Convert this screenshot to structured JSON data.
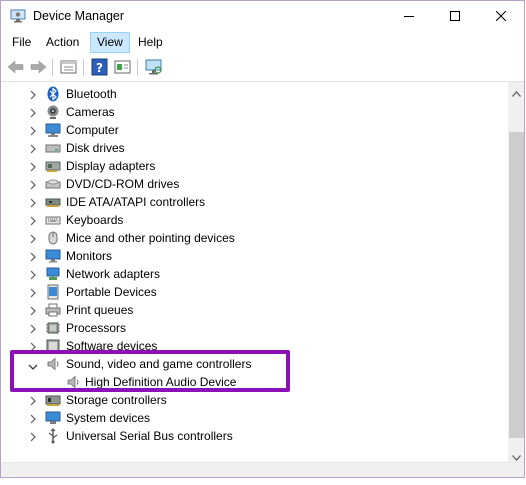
{
  "window": {
    "title": "Device Manager"
  },
  "titlebar": {
    "icon": "device-manager-icon",
    "minimize_icon": "minimize-icon",
    "maximize_icon": "maximize-icon",
    "close_icon": "close-icon"
  },
  "menubar": {
    "items": [
      "File",
      "Action",
      "View",
      "Help"
    ],
    "active": "View"
  },
  "toolbar": {
    "icons": [
      "back-arrow-icon",
      "forward-arrow-icon",
      "properties-icon",
      "help-icon",
      "show-hidden-icon",
      "scan-hardware-icon"
    ]
  },
  "tree": {
    "items": [
      {
        "label": "Bluetooth",
        "icon": "bluetooth-icon"
      },
      {
        "label": "Cameras",
        "icon": "camera-icon"
      },
      {
        "label": "Computer",
        "icon": "computer-icon"
      },
      {
        "label": "Disk drives",
        "icon": "disk-drive-icon"
      },
      {
        "label": "Display adapters",
        "icon": "display-adapter-icon"
      },
      {
        "label": "DVD/CD-ROM drives",
        "icon": "dvd-drive-icon"
      },
      {
        "label": "IDE ATA/ATAPI controllers",
        "icon": "ide-controller-icon"
      },
      {
        "label": "Keyboards",
        "icon": "keyboard-icon"
      },
      {
        "label": "Mice and other pointing devices",
        "icon": "mouse-icon"
      },
      {
        "label": "Monitors",
        "icon": "monitor-icon"
      },
      {
        "label": "Network adapters",
        "icon": "network-adapter-icon"
      },
      {
        "label": "Portable Devices",
        "icon": "portable-device-icon"
      },
      {
        "label": "Print queues",
        "icon": "printer-icon"
      },
      {
        "label": "Processors",
        "icon": "processor-icon"
      },
      {
        "label": "Software devices",
        "icon": "software-device-icon"
      },
      {
        "label": "Sound, video and game controllers",
        "icon": "speaker-icon",
        "expanded": true
      },
      {
        "label": "High Definition Audio Device",
        "icon": "speaker-icon",
        "child": true
      },
      {
        "label": "Storage controllers",
        "icon": "storage-controller-icon"
      },
      {
        "label": "System devices",
        "icon": "system-device-icon"
      },
      {
        "label": "Universal Serial Bus controllers",
        "icon": "usb-controller-icon"
      }
    ]
  },
  "colors": {
    "highlight_border": "#8b10b8",
    "menu_active_bg": "#cce8ff",
    "chevron": "#5a5a5a"
  }
}
